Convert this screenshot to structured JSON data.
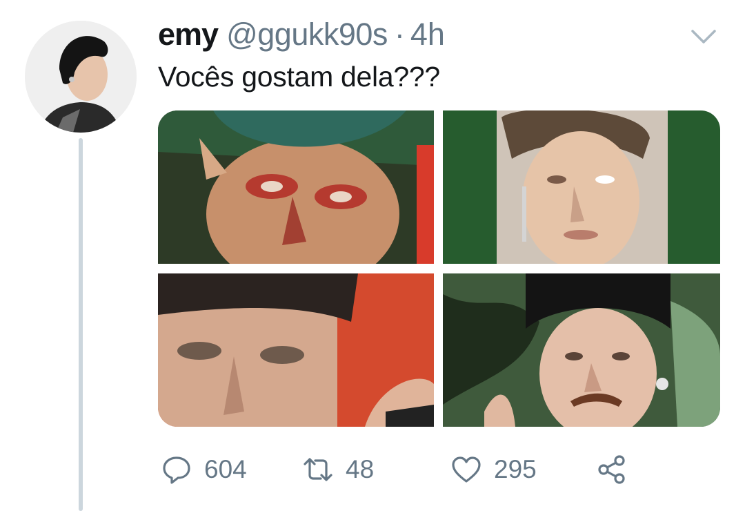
{
  "tweet": {
    "author_name": "emy",
    "author_handle": "@ggukk90s",
    "separator": "·",
    "timestamp": "4h",
    "text": "Vocês gostam dela???",
    "media_count": 4
  },
  "actions": {
    "reply_count": "604",
    "retweet_count": "48",
    "like_count": "295"
  },
  "icons": [
    "chevron-down-icon",
    "reply-icon",
    "retweet-icon",
    "heart-icon",
    "share-icon"
  ],
  "colors": {
    "text_primary": "#14171a",
    "text_secondary": "#657786",
    "thread_line": "#ccd6dd",
    "background": "#ffffff"
  }
}
